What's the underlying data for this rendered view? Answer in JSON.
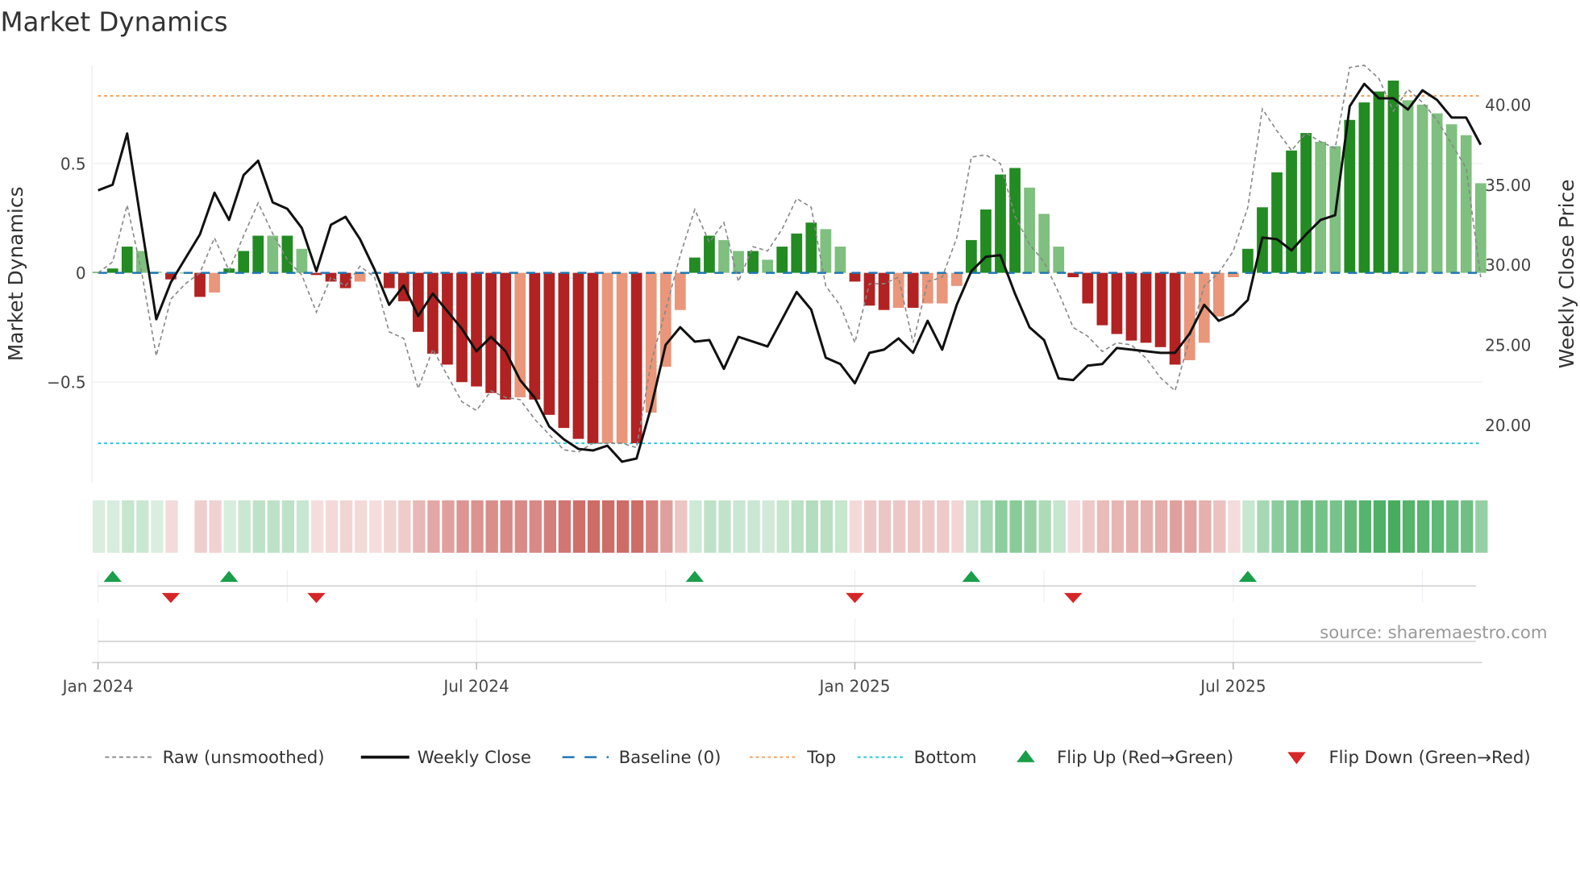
{
  "title": "Market Dynamics",
  "source": "source: sharemaestro.com",
  "colors": {
    "strong_green": "#228b22",
    "light_green": "#7fbf7f",
    "strong_red": "#b22222",
    "light_red": "#e9967a",
    "close": "#111111",
    "raw": "#888888",
    "baseline": "#1f77b4",
    "top": "#f4a261",
    "bottom": "#2ec4d6",
    "flip_up": "#1a9e4a",
    "flip_down": "#d62728"
  },
  "chart_data": {
    "type": "bar+line",
    "title": "Market Dynamics",
    "ylabel": "Market Dynamics",
    "y2label": "Weekly Close Price",
    "ylim": [
      -0.95,
      0.95
    ],
    "y2lim": [
      16.0,
      43.8
    ],
    "yticks": [
      {
        "v": 0.5,
        "label": "0.5"
      },
      {
        "v": 0,
        "label": "0"
      },
      {
        "v": -0.5,
        "label": "−0.5"
      }
    ],
    "y2ticks": [
      {
        "v": 40,
        "label": "40.00"
      },
      {
        "v": 35,
        "label": "35.00"
      },
      {
        "v": 30,
        "label": "30.00"
      },
      {
        "v": 25,
        "label": "25.00"
      },
      {
        "v": 20,
        "label": "20.00"
      }
    ],
    "xticks": [
      {
        "week": 0,
        "label": "Jan 2024"
      },
      {
        "week": 26,
        "label": "Jul 2024"
      },
      {
        "week": 52,
        "label": "Jan 2025"
      },
      {
        "week": 78,
        "label": "Jul 2025"
      }
    ],
    "minor_xgrid_weeks": [
      13,
      39,
      65,
      91
    ],
    "weeks": 96,
    "top_level": 0.81,
    "bottom_level": -0.78,
    "baseline": 0,
    "momentum": [
      0.004,
      0.02,
      0.12,
      0.1,
      0.005,
      -0.03,
      0,
      -0.11,
      -0.09,
      0.02,
      0.1,
      0.17,
      0.17,
      0.17,
      0.11,
      -0.01,
      -0.04,
      -0.07,
      -0.04,
      -0.005,
      -0.07,
      -0.13,
      -0.27,
      -0.37,
      -0.42,
      -0.5,
      -0.52,
      -0.55,
      -0.58,
      -0.57,
      -0.58,
      -0.65,
      -0.71,
      -0.76,
      -0.78,
      -0.78,
      -0.78,
      -0.78,
      -0.64,
      -0.43,
      -0.17,
      0.07,
      0.17,
      0.15,
      0.1,
      0.1,
      0.06,
      0.12,
      0.18,
      0.23,
      0.2,
      0.12,
      -0.04,
      -0.15,
      -0.17,
      -0.16,
      -0.16,
      -0.14,
      -0.14,
      -0.06,
      0.15,
      0.29,
      0.45,
      0.48,
      0.39,
      0.27,
      0.12,
      -0.02,
      -0.14,
      -0.24,
      -0.28,
      -0.31,
      -0.32,
      -0.34,
      -0.42,
      -0.4,
      -0.32,
      -0.2,
      -0.02,
      0.11,
      0.3,
      0.46,
      0.56,
      0.64,
      0.6,
      0.58,
      0.7,
      0.78,
      0.83,
      0.88,
      0.79,
      0.77,
      0.73,
      0.68,
      0.63,
      0.41
    ],
    "shade": "SSSLLSSSLSSSLSLSSSLLSSSSSSSSSLSSSSSLLSLLLSSLLSLSSSLLSSSLSLLLSSSSLLLSSSSSSSSLLLLSSSSSLLSSSSLLLLLL",
    "raw": [
      0,
      0.05,
      0.31,
      0,
      -0.38,
      -0.12,
      -0.05,
      0,
      0.16,
      0.01,
      0.17,
      0.32,
      0.18,
      0.06,
      -0.01,
      -0.18,
      -0.02,
      -0.06,
      0.03,
      -0.02,
      -0.27,
      -0.3,
      -0.53,
      -0.35,
      -0.47,
      -0.59,
      -0.63,
      -0.54,
      -0.57,
      -0.58,
      -0.67,
      -0.74,
      -0.81,
      -0.82,
      -0.78,
      -0.78,
      -0.78,
      -0.8,
      -0.41,
      -0.17,
      0.08,
      0.29,
      0.14,
      0.23,
      -0.04,
      0.12,
      0.1,
      0.2,
      0.34,
      0.3,
      -0.06,
      -0.15,
      -0.32,
      -0.05,
      -0.05,
      -0.02,
      -0.32,
      -0.04,
      -0.02,
      0.16,
      0.53,
      0.54,
      0.5,
      0.26,
      0.13,
      0.05,
      -0.09,
      -0.25,
      -0.29,
      -0.36,
      -0.32,
      -0.33,
      -0.39,
      -0.48,
      -0.54,
      -0.3,
      -0.06,
      0,
      0.1,
      0.3,
      0.75,
      0.65,
      0.56,
      0.64,
      0.6,
      0.57,
      0.94,
      0.95,
      0.89,
      0.74,
      0.84,
      0.78,
      0.7,
      0.59,
      0.48,
      -0.02
    ],
    "close": [
      34.65,
      35.0,
      38.2,
      32.4,
      26.6,
      28.9,
      30.4,
      31.9,
      34.5,
      32.8,
      35.6,
      36.5,
      33.9,
      33.5,
      32.3,
      29.6,
      32.5,
      33.0,
      31.6,
      29.7,
      27.5,
      28.7,
      26.8,
      28.2,
      27.1,
      26.0,
      24.6,
      25.5,
      24.6,
      22.8,
      21.7,
      19.9,
      19.1,
      18.5,
      18.4,
      18.7,
      17.7,
      17.9,
      21.1,
      25.0,
      26.1,
      25.2,
      25.3,
      23.5,
      25.5,
      25.2,
      24.9,
      26.6,
      28.3,
      27.2,
      24.2,
      23.8,
      22.6,
      24.5,
      24.7,
      25.4,
      24.5,
      26.5,
      24.7,
      27.5,
      29.6,
      30.5,
      30.6,
      28.2,
      26.1,
      25.3,
      22.9,
      22.8,
      23.7,
      23.8,
      24.8,
      24.7,
      24.6,
      24.5,
      24.5,
      25.7,
      27.5,
      26.5,
      26.9,
      27.8,
      31.7,
      31.6,
      30.9,
      31.9,
      32.8,
      33.1,
      39.9,
      41.3,
      40.4,
      40.4,
      39.7,
      40.9,
      40.3,
      39.2,
      39.2,
      37.5
    ],
    "flip_up_weeks": [
      1,
      9,
      41,
      60,
      79
    ],
    "flip_down_weeks": [
      5,
      15,
      52,
      67
    ],
    "legend": [
      {
        "key": "raw",
        "label": "Raw (unsmoothed)"
      },
      {
        "key": "close",
        "label": "Weekly Close"
      },
      {
        "key": "baseline",
        "label": "Baseline (0)"
      },
      {
        "key": "top",
        "label": "Top"
      },
      {
        "key": "bottom",
        "label": "Bottom"
      },
      {
        "key": "flip_up",
        "label": "Flip Up (Red→Green)"
      },
      {
        "key": "flip_down",
        "label": "Flip Down (Green→Red)"
      }
    ],
    "legend_position": "bottom"
  }
}
